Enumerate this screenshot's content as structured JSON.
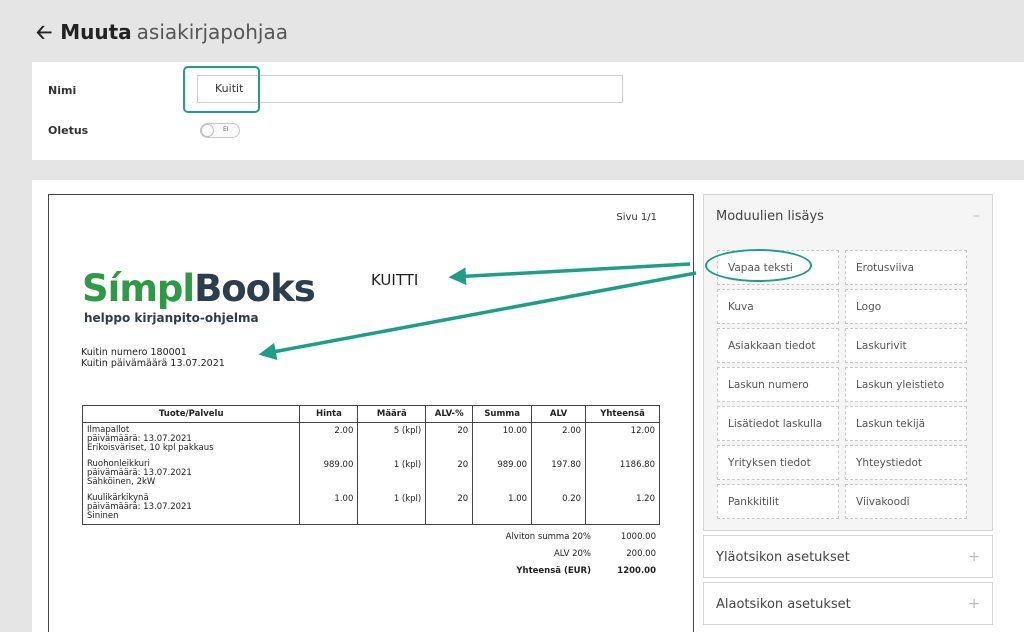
{
  "header": {
    "title_strong": "Muuta",
    "title_rest": "asiakirjapohjaa"
  },
  "form": {
    "name_label": "Nimi",
    "name_value": "Kuitit",
    "default_label": "Oletus",
    "default_toggle_text": "EI",
    "default_enabled": false
  },
  "document": {
    "page_number": "Sivu 1/1",
    "title": "KUITTI",
    "logo": {
      "word1": "Símpl",
      "word2": "Books",
      "tagline": "helppo kirjanpito-ohjelma"
    },
    "receipt_number": "Kuitin numero 180001",
    "receipt_date": "Kuitin päivämäärä 13.07.2021",
    "table": {
      "headers": [
        "Tuote/Palvelu",
        "Hinta",
        "Määrä",
        "ALV-%",
        "Summa",
        "ALV",
        "Yhteensä"
      ],
      "rows": [
        {
          "product": "Ilmapallot",
          "date": "päivämäärä: 13.07.2021",
          "extra": "Erikoisväriset, 10 kpl pakkaus",
          "price": "2.00",
          "qty": "5 (kpl)",
          "vat_pct": "20",
          "sum": "10.00",
          "vat": "2.00",
          "total": "12.00"
        },
        {
          "product": "Ruohonleikkuri",
          "date": "päivämäärä: 13.07.2021",
          "extra": "Sähköinen, 2kW",
          "price": "989.00",
          "qty": "1 (kpl)",
          "vat_pct": "20",
          "sum": "989.00",
          "vat": "197.80",
          "total": "1186.80"
        },
        {
          "product": "Kuulikärkikynä",
          "date": "päivämäärä: 13.07.2021",
          "extra": "Sininen",
          "price": "1.00",
          "qty": "1 (kpl)",
          "vat_pct": "20",
          "sum": "1.00",
          "vat": "0.20",
          "total": "1.20"
        }
      ]
    },
    "totals": [
      {
        "label": "Alviton summa 20%",
        "value": "1000.00",
        "bold": false
      },
      {
        "label": "ALV 20%",
        "value": "200.00",
        "bold": false
      },
      {
        "label": "Yhteensä (EUR)",
        "value": "1200.00",
        "bold": true
      }
    ]
  },
  "modules_panel": {
    "title": "Moduulien lisäys",
    "toggle_symbol": "–",
    "items": [
      "Vapaa teksti",
      "Erotusviiva",
      "Kuva",
      "Logo",
      "Asiakkaan tiedot",
      "Laskurivit",
      "Laskun numero",
      "Laskun yleistieto",
      "Lisätiedot laskulla",
      "Laskun tekijä",
      "Yrityksen tiedot",
      "Yhteystiedot",
      "Pankkitilit",
      "Viivakoodi"
    ]
  },
  "header_settings_panel": {
    "title": "Yläotsikon asetukset",
    "toggle_symbol": "+"
  },
  "footer_settings_panel": {
    "title": "Alaotsikon asetukset",
    "toggle_symbol": "+"
  },
  "colors": {
    "accent": "#1f9e87",
    "logo_green": "#2e9a45",
    "logo_dark": "#2c3e4b"
  }
}
